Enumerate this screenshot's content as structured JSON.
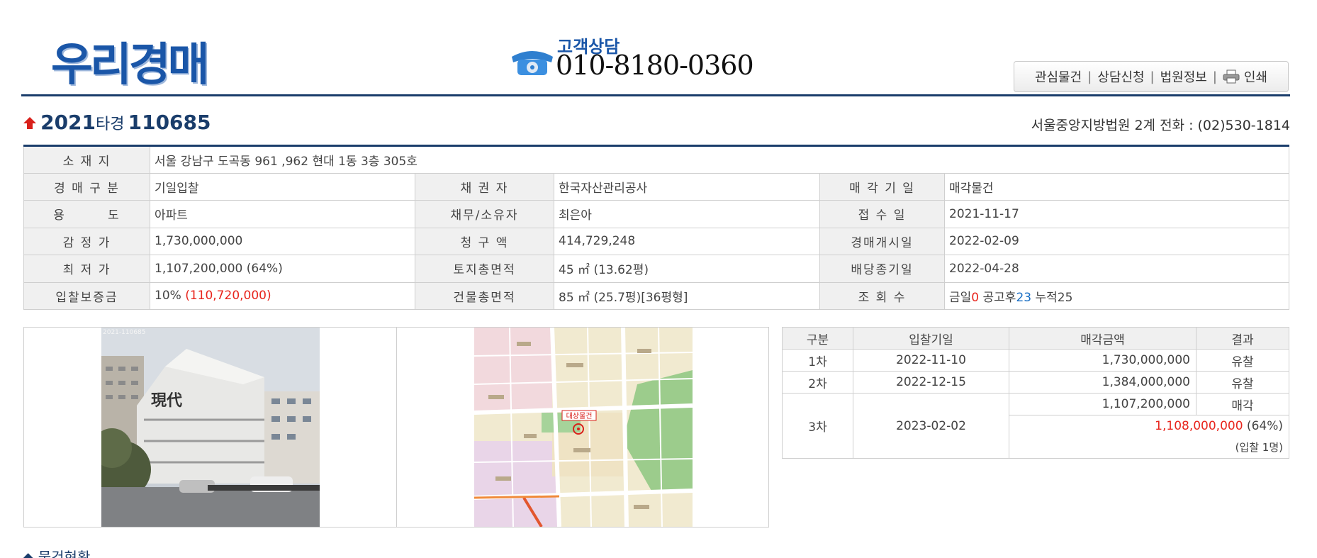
{
  "header": {
    "logo": "우리경매",
    "hotline_label": "고객상담",
    "hotline_number": "010-8180-0360",
    "links": [
      "관심물건",
      "상담신청",
      "법원정보",
      "인쇄"
    ],
    "separator": "|"
  },
  "case": {
    "year": "2021",
    "kind": "타경",
    "number": "110685",
    "court": "서울중앙지방법원 2계  전화 : (02)530-1814"
  },
  "info": {
    "address_label": "소 재 지",
    "address": "서울 강남구 도곡동 961 ,962 현대 1동 3층 305호",
    "rows": [
      [
        {
          "l": "경 매 구 분",
          "v": "기일입찰"
        },
        {
          "l": "채  권  자",
          "v": "한국자산관리공사"
        },
        {
          "l": "매 각 기 일",
          "v": "매각물건"
        }
      ],
      [
        {
          "l": "용        도",
          "v": "아파트"
        },
        {
          "l": "채무/소유자",
          "v": "최은아"
        },
        {
          "l": "접  수  일",
          "v": "2021-11-17"
        }
      ],
      [
        {
          "l": "감  정  가",
          "v": "1,730,000,000"
        },
        {
          "l": "청  구  액",
          "v": "414,729,248"
        },
        {
          "l": "경매개시일",
          "v": "2022-02-09"
        }
      ],
      [
        {
          "l": "최  저  가",
          "v": "1,107,200,000 (64%)"
        },
        {
          "l": "토지총면적",
          "v": "45 ㎡ (13.62평)"
        },
        {
          "l": "배당종기일",
          "v": "2022-04-28"
        }
      ]
    ],
    "deposit_label": "입찰보증금",
    "deposit_pct": "10% ",
    "deposit_amt": "(110,720,000)",
    "bldg_area_label": "건물총면적",
    "bldg_area": "85 ㎡ (25.7평)[36평형]",
    "views_label": "조  회  수",
    "views": {
      "today_label": "금일",
      "today": "0",
      "after_label": " 공고후",
      "after": "23",
      "total_label": " 누적",
      "total": "25"
    }
  },
  "photos": {
    "photo_caption": "2021-110685",
    "map_marker_label": "대상물건"
  },
  "results": {
    "headers": [
      "구분",
      "입찰기일",
      "매각금액",
      "결과"
    ],
    "rows": [
      {
        "round": "1차",
        "date": "2022-11-10",
        "amount": "1,730,000,000",
        "result": "유찰"
      },
      {
        "round": "2차",
        "date": "2022-12-15",
        "amount": "1,384,000,000",
        "result": "유찰"
      }
    ],
    "final": {
      "round": "3차",
      "date": "2023-02-02",
      "min_amount": "1,107,200,000",
      "result": "매각",
      "sale_amount": "1,108,000,000",
      "sale_pct": " (64%)",
      "bidders": "(입찰 1명)"
    }
  },
  "section_title": "◆ 물건현황",
  "colors": {
    "brand": "#1a56a8",
    "navy": "#1a3d6b",
    "red": "#e8251d"
  }
}
